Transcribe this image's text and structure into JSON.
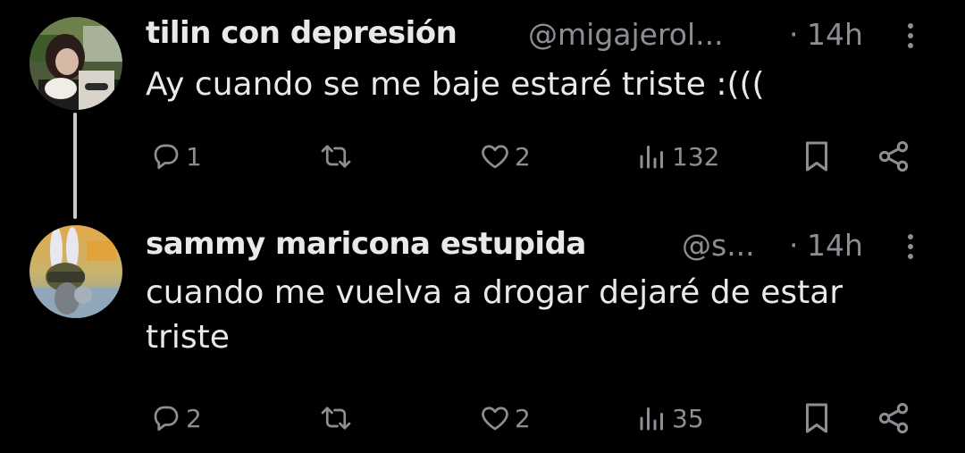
{
  "tweets": [
    {
      "display_name": "tilin con depresión",
      "handle": "@migajerol...",
      "separator": "·",
      "time": "14h",
      "text": "Ay cuando se me baje estaré triste :(((",
      "stats": {
        "replies": "1",
        "reposts": "",
        "likes": "2",
        "views": "132"
      }
    },
    {
      "display_name": "sammy maricona estupida",
      "handle": "@s...",
      "separator": "·",
      "time": "14h",
      "text": "cuando me vuelva a drogar dejaré de estar triste",
      "stats": {
        "replies": "2",
        "reposts": "",
        "likes": "2",
        "views": "35"
      }
    }
  ],
  "icons": {
    "reply": "reply-icon",
    "repost": "repost-icon",
    "like": "heart-icon",
    "views": "views-icon",
    "bookmark": "bookmark-icon",
    "share": "share-icon",
    "more": "more-vertical-icon"
  },
  "colors": {
    "background": "#000000",
    "text_primary": "#e7e9ea",
    "text_secondary": "#8b8f94",
    "thread_line": "#c9c9c9"
  }
}
